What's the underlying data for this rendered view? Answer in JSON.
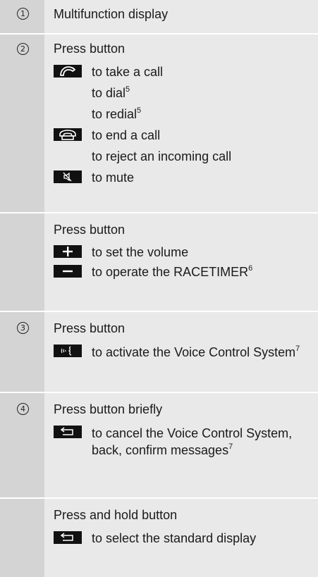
{
  "rows": [
    {
      "num": "1",
      "title": "Multifunction display",
      "entries": []
    },
    {
      "num": "2",
      "title": "Press button",
      "entries": [
        {
          "icon": "phone-pickup-icon",
          "lines": [
            [
              "to take a call",
              ""
            ],
            [
              "to dial",
              "5"
            ],
            [
              "to redial",
              "5"
            ]
          ]
        },
        {
          "icon": "phone-hangup-icon",
          "lines": [
            [
              "to end a call",
              ""
            ],
            [
              "to reject an incoming call",
              ""
            ]
          ]
        },
        {
          "icon": "mute-icon",
          "lines": [
            [
              "to mute",
              ""
            ]
          ]
        }
      ]
    },
    {
      "num": "",
      "title": "Press button",
      "entries": [
        {
          "icon": "plus-icon",
          "lines": [
            [
              "to set the volume",
              ""
            ]
          ]
        },
        {
          "icon": "minus-icon",
          "lines": [
            [
              "to operate the RACETIMER",
              "6"
            ]
          ]
        }
      ]
    },
    {
      "num": "3",
      "title": "Press button",
      "entries": [
        {
          "icon": "voice-control-icon",
          "lines": [
            [
              "to activate the Voice Control System",
              "7"
            ]
          ]
        }
      ]
    },
    {
      "num": "4",
      "title": "Press button briefly",
      "entries": [
        {
          "icon": "back-icon",
          "lines": [
            [
              "to cancel the Voice Control System, back, confirm messages",
              "7"
            ]
          ]
        }
      ]
    },
    {
      "num": "",
      "title": "Press and hold button",
      "entries": [
        {
          "icon": "back-icon",
          "lines": [
            [
              "to select the standard display",
              ""
            ]
          ]
        }
      ]
    }
  ]
}
